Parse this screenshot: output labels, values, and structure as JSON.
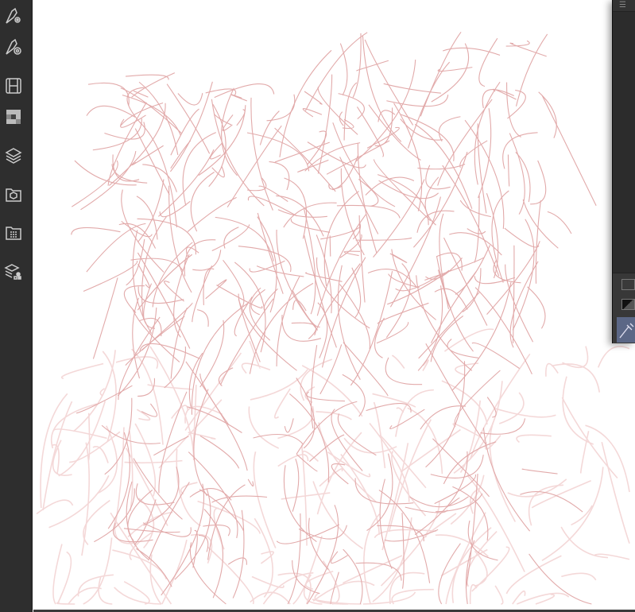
{
  "sidebar": {
    "items": [
      {
        "icon": "pen-settings-icon"
      },
      {
        "icon": "pen-target-icon"
      },
      {
        "icon": "animation-timeline-icon"
      },
      {
        "icon": "color-set-icon"
      },
      {
        "icon": "layers-icon"
      },
      {
        "icon": "material-3d-icon"
      },
      {
        "icon": "material-folder-icon"
      },
      {
        "icon": "layer-property-icon"
      }
    ]
  },
  "right_panel": {
    "menu_icon": "hamburger-menu-icon",
    "tools": [
      "swatch-icon",
      "gradient-icon",
      "eyedropper-icon"
    ]
  },
  "colors": {
    "sidebar_bg": "#2e2e2e",
    "sketch_stroke": "#e2aaaa",
    "sketch_faint": "#f4d8d8",
    "selected_tool": "#5b6786"
  }
}
